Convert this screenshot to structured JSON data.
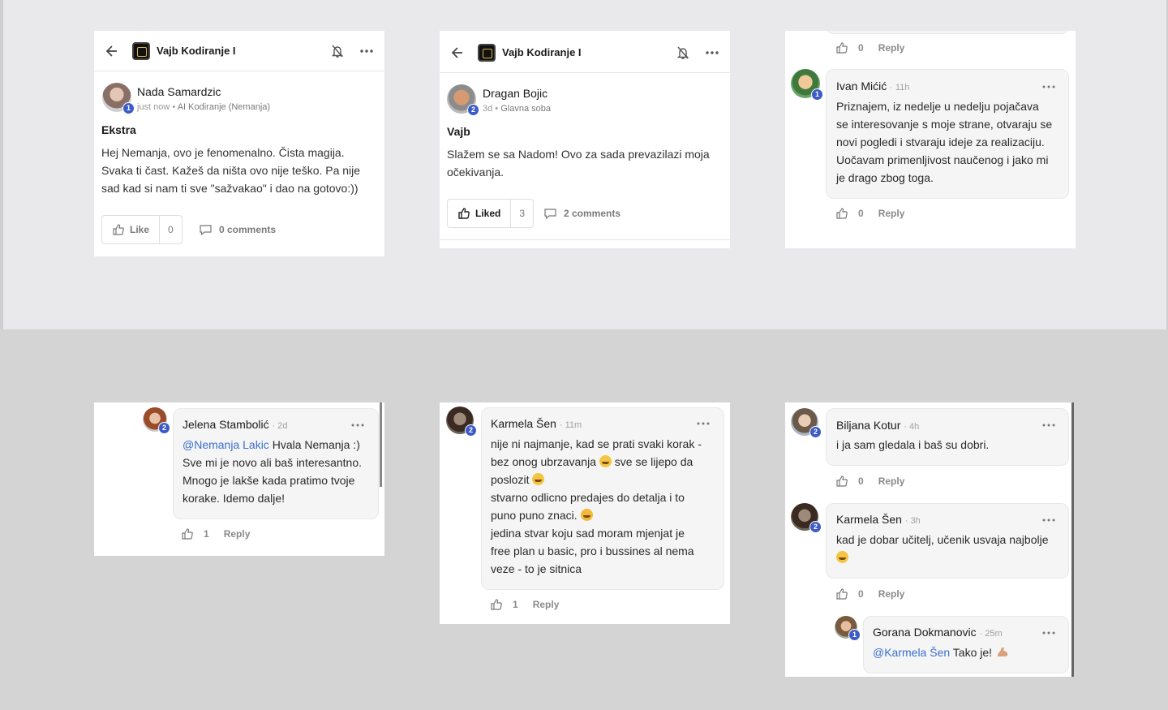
{
  "group": {
    "name": "Vajb Kodiranje I"
  },
  "post1": {
    "author": "Nada Samardzic",
    "level": "1",
    "time": "just now",
    "room": "AI Kodiranje (Nemanja)",
    "title": "Ekstra",
    "lines": [
      "Hej Nemanja, ovo je fenomenalno. Čista magija.",
      "Svaka ti čast. Kažeš da ništa ovo nije teško. Pa nije",
      "sad kad si nam ti sve \"sažvakao\" i dao na gotovo:))"
    ],
    "like_label": "Like",
    "like_count": "0",
    "comments_label": "0 comments"
  },
  "post2": {
    "author": "Dragan Bojic",
    "level": "2",
    "time": "3d",
    "room": "Glavna soba",
    "title": "Vajb",
    "lines": [
      "Slažem se sa Nadom! Ovo za sada prevazilazi moja",
      "očekivanja."
    ],
    "like_label": "Liked",
    "like_count": "3",
    "comments_label": "2 comments"
  },
  "panel3": {
    "top_actions": {
      "count": "0",
      "reply": "Reply"
    },
    "comment": {
      "author": "Ivan Mićić",
      "time": "11h",
      "level": "1",
      "lines": [
        "Priznajem, iz nedelje u nedelju pojačava",
        "se interesovanje s moje strane, otvaraju se",
        "novi pogledi i stvaraju ideje za realizaciju.",
        "Uočavam primenljivost naučenog i jako mi",
        "je drago zbog toga."
      ],
      "count": "0",
      "reply": "Reply"
    }
  },
  "panel4": {
    "author": "Jelena Stambolić",
    "time": "2d",
    "level": "2",
    "mention": "@Nemanja Lakic",
    "first_rest": " Hvala Nemanja :)",
    "lines": [
      "Sve mi je novo ali baš interesantno.",
      "Mnogo je lakše kada pratimo tvoje",
      "korake. Idemo dalje!"
    ],
    "count": "1",
    "reply": "Reply"
  },
  "panel5": {
    "author": "Karmela Šen",
    "time": "11m",
    "level": "2",
    "l1": "nije ni najmanje, kad se prati svaki korak -",
    "l2a": "bez onog ubrzavanja",
    "l2b": " sve se lijepo da",
    "l3": "poslozit",
    "l4": "stvarno odlicno predajes do detalja i to",
    "l5": "puno puno znaci.",
    "l6": "jedina stvar koju sad moram mjenjat je",
    "l7": "free plan u basic, pro i bussines al nema",
    "l8": "veze - to je sitnica",
    "count": "1",
    "reply": "Reply"
  },
  "panel6": {
    "c1": {
      "author": "Biljana Kotur",
      "time": "4h",
      "level": "2",
      "text": "i ja sam gledala i baš su dobri.",
      "count": "0",
      "reply": "Reply"
    },
    "c2": {
      "author": "Karmela Šen",
      "time": "3h",
      "level": "2",
      "text": "kad je dobar učitelj, učenik usvaja najbolje",
      "count": "0",
      "reply": "Reply"
    },
    "c3": {
      "author": "Gorana Dokmanovic",
      "time": "25m",
      "level": "1",
      "mention": "@Karmela Šen",
      "rest": " Tako je!"
    }
  },
  "colors": {
    "badge": "#3c5bc7",
    "mention": "#3b6fd1",
    "bg_top": "#e9e9eb",
    "bg_bottom": "#d3d4d3"
  },
  "icons": [
    "back-arrow-icon",
    "group-logo-icon",
    "bell-off-icon",
    "more-icon",
    "thumbs-up-icon",
    "comment-icon"
  ]
}
